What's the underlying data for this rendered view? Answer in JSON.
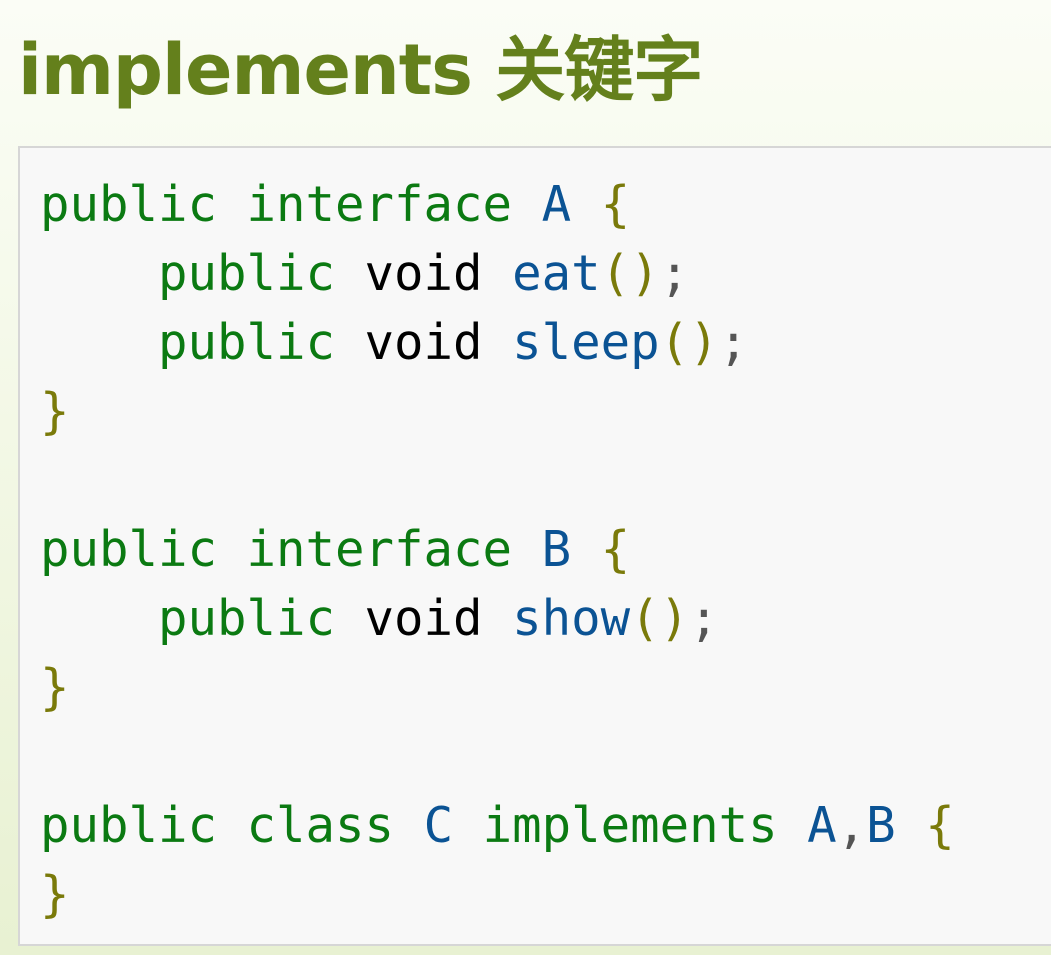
{
  "heading": "implements 关键字",
  "code": {
    "lines": [
      [
        {
          "t": "public",
          "k": "kw"
        },
        {
          "t": " "
        },
        {
          "t": "interface",
          "k": "kw"
        },
        {
          "t": " "
        },
        {
          "t": "A",
          "k": "id"
        },
        {
          "t": " "
        },
        {
          "t": "{",
          "k": "pun"
        }
      ],
      [
        {
          "t": "    "
        },
        {
          "t": "public",
          "k": "kw"
        },
        {
          "t": " "
        },
        {
          "t": "void",
          "k": "ty"
        },
        {
          "t": " "
        },
        {
          "t": "eat",
          "k": "id"
        },
        {
          "t": "()",
          "k": "pun"
        },
        {
          "t": ";",
          "k": "sem"
        }
      ],
      [
        {
          "t": "    "
        },
        {
          "t": "public",
          "k": "kw"
        },
        {
          "t": " "
        },
        {
          "t": "void",
          "k": "ty"
        },
        {
          "t": " "
        },
        {
          "t": "sleep",
          "k": "id"
        },
        {
          "t": "()",
          "k": "pun"
        },
        {
          "t": ";",
          "k": "sem"
        }
      ],
      [
        {
          "t": "}",
          "k": "pun"
        }
      ],
      [],
      [
        {
          "t": "public",
          "k": "kw"
        },
        {
          "t": " "
        },
        {
          "t": "interface",
          "k": "kw"
        },
        {
          "t": " "
        },
        {
          "t": "B",
          "k": "id"
        },
        {
          "t": " "
        },
        {
          "t": "{",
          "k": "pun"
        }
      ],
      [
        {
          "t": "    "
        },
        {
          "t": "public",
          "k": "kw"
        },
        {
          "t": " "
        },
        {
          "t": "void",
          "k": "ty"
        },
        {
          "t": " "
        },
        {
          "t": "show",
          "k": "id"
        },
        {
          "t": "()",
          "k": "pun"
        },
        {
          "t": ";",
          "k": "sem"
        }
      ],
      [
        {
          "t": "}",
          "k": "pun"
        }
      ],
      [],
      [
        {
          "t": "public",
          "k": "kw"
        },
        {
          "t": " "
        },
        {
          "t": "class",
          "k": "kw"
        },
        {
          "t": " "
        },
        {
          "t": "C",
          "k": "id"
        },
        {
          "t": " "
        },
        {
          "t": "implements",
          "k": "kw"
        },
        {
          "t": " "
        },
        {
          "t": "A",
          "k": "id"
        },
        {
          "t": ",",
          "k": "sem"
        },
        {
          "t": "B",
          "k": "id"
        },
        {
          "t": " "
        },
        {
          "t": "{",
          "k": "pun"
        }
      ],
      [
        {
          "t": "}",
          "k": "pun"
        }
      ]
    ]
  },
  "colors": {
    "heading": "#64801c",
    "keyword": "#0b7a12",
    "type": "#000000",
    "identifier": "#0b5394",
    "punctuation": "#7a7a0a",
    "semicolon": "#555555",
    "code_background": "#f8f8f8"
  }
}
